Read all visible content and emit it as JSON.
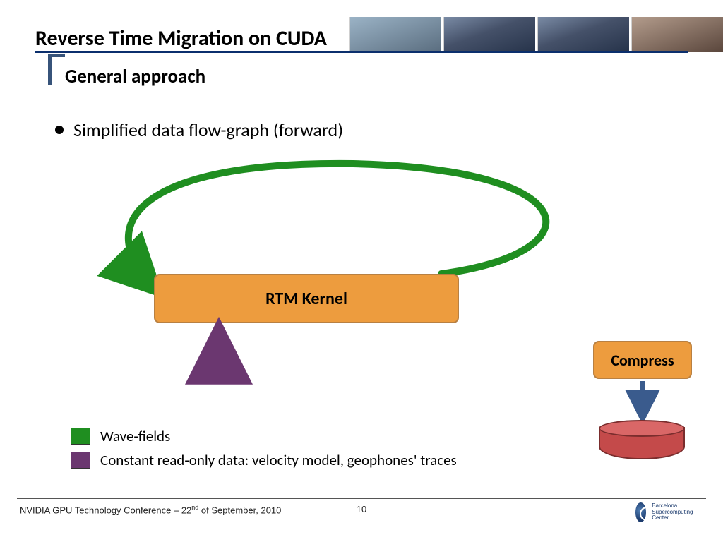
{
  "header": {
    "title": "Reverse Time Migration on CUDA",
    "subtitle": "General approach"
  },
  "bullet": {
    "text": "Simplified data flow-graph (forward)"
  },
  "diagram": {
    "rtm_kernel_label": "RTM Kernel",
    "compress_label": "Compress",
    "loop_arrow_color": "#1f8e20",
    "wavefield_arrow_color": "#6b3770",
    "compress_arrow_color": "#3a5b8d"
  },
  "legend": {
    "items": [
      {
        "swatch": "green",
        "label": "Wave-fields"
      },
      {
        "swatch": "purple",
        "label": "Constant read-only data: velocity model, geophones' traces"
      }
    ]
  },
  "footer": {
    "conference_prefix": "NVIDIA GPU Technology Conference – 22",
    "conference_ordinal": "nd",
    "conference_suffix": " of September, 2010",
    "page_number": "10",
    "logo_text": "Barcelona Supercomputing Center"
  }
}
